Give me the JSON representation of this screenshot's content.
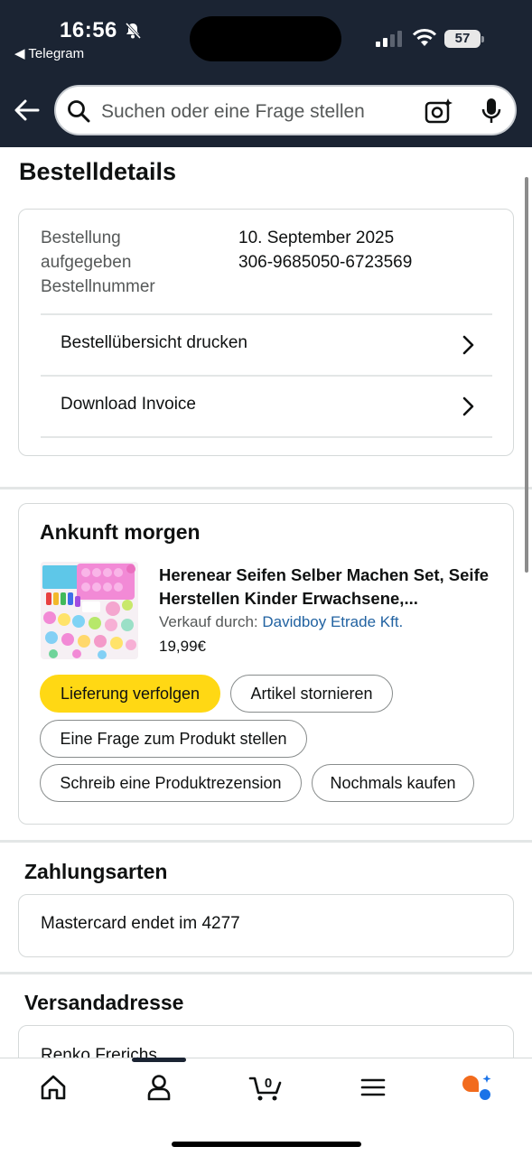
{
  "status_bar": {
    "time": "16:56",
    "back_app": "◀ Telegram",
    "battery": "57"
  },
  "search": {
    "placeholder": "Suchen oder eine Frage stellen"
  },
  "page_title": "Bestelldetails",
  "order": {
    "labels": [
      "Bestellung",
      "aufgegeben",
      "Bestellnummer"
    ],
    "date": "10. September 2025",
    "number": "306-9685050-6723569",
    "links": [
      "Bestellübersicht drucken",
      "Download Invoice"
    ]
  },
  "shipment": {
    "heading": "Ankunft morgen",
    "product_title": "Herenear Seifen Selber Machen Set, Seife Herstellen Kinder Erwachsene,...",
    "seller_label": "Verkauf durch:",
    "seller_name": "Davidboy Etrade Kft.",
    "price": "19,99€",
    "buttons": {
      "track": "Lieferung verfolgen",
      "cancel": "Artikel stornieren",
      "question": "Eine Frage zum Produkt stellen",
      "review": "Schreib eine Produktrezension",
      "buy_again": "Nochmals kaufen"
    }
  },
  "payment": {
    "heading": "Zahlungsarten",
    "method": "Mastercard  endet im 4277"
  },
  "shipping": {
    "heading": "Versandadresse",
    "name": "Renko Frerichs"
  },
  "bottom_nav": {
    "cart_count": "0",
    "items": [
      "home-icon",
      "account-icon",
      "cart-icon",
      "menu-icon",
      "rufus-icon"
    ]
  },
  "colors": {
    "header_bg": "#1b2433",
    "primary_button": "#ffd814",
    "link": "#2162a1"
  }
}
